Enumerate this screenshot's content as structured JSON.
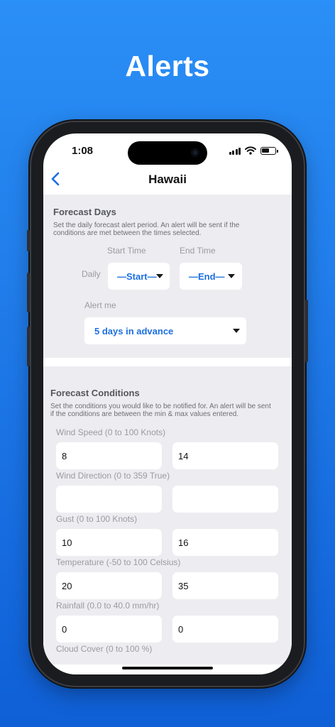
{
  "headline": "Alerts",
  "status": {
    "time": "1:08",
    "battery_level": 0.6
  },
  "nav": {
    "title": "Hawaii"
  },
  "forecast_days": {
    "title": "Forecast Days",
    "description": "Set the daily forecast alert period. An alert will be sent if the conditions are met between the times selected.",
    "start_time_label": "Start Time",
    "end_time_label": "End Time",
    "daily_label": "Daily",
    "start_value": "—Start—",
    "end_value": "—End—",
    "alert_me_label": "Alert me",
    "alert_me_value": "5 days in advance"
  },
  "forecast_conditions": {
    "title": "Forecast Conditions",
    "description": "Set the conditions you would like to be notified for. An alert will be sent if the conditions are between the min & max values entered.",
    "fields": [
      {
        "label": "Wind Speed (0 to 100 Knots)",
        "min": "8",
        "max": "14"
      },
      {
        "label": "Wind Direction (0 to 359 True)",
        "min": "",
        "max": ""
      },
      {
        "label": "Gust (0 to 100 Knots)",
        "min": "10",
        "max": "16"
      },
      {
        "label": "Temperature (-50 to 100 Celsius)",
        "min": "20",
        "max": "35"
      },
      {
        "label": "Rainfall (0.0 to 40.0 mm/hr)",
        "min": "0",
        "max": "0"
      },
      {
        "label": "Cloud Cover (0 to 100 %)"
      }
    ]
  },
  "colors": {
    "accent": "#1b6fe0",
    "background_top": "#2a8ff6",
    "background_bottom": "#0f5fd6",
    "panel": "#ededf1"
  }
}
